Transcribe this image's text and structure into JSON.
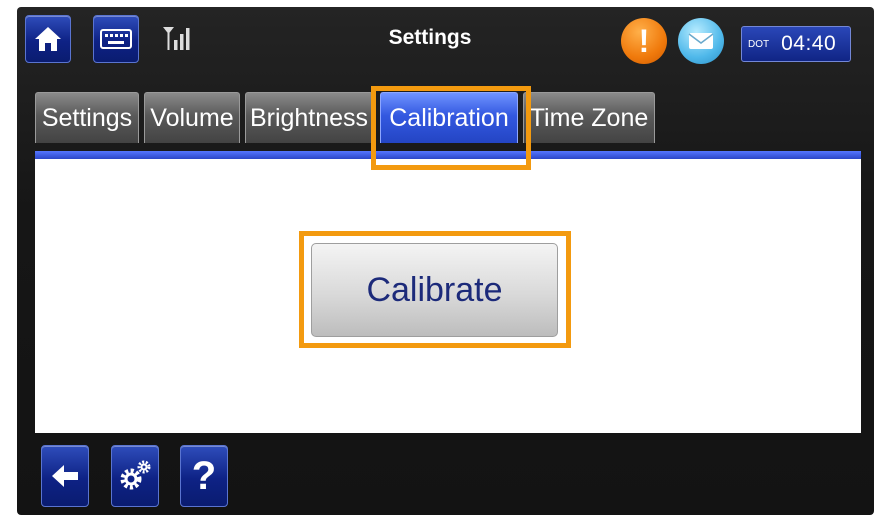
{
  "header": {
    "title": "Settings",
    "clock": {
      "timezone": "DOT",
      "time": "04:40"
    }
  },
  "tabs": [
    {
      "label": "Settings",
      "active": false
    },
    {
      "label": "Volume",
      "active": false
    },
    {
      "label": "Brightness",
      "active": false
    },
    {
      "label": "Calibration",
      "active": true
    },
    {
      "label": "Time Zone",
      "active": false
    }
  ],
  "main": {
    "calibrate_label": "Calibrate"
  },
  "footer": {
    "help_label": "?"
  },
  "icons": {
    "home": "home-icon",
    "keyboard": "keyboard-icon",
    "signal": "signal-icon",
    "alert": "alert-icon",
    "mail": "mail-icon",
    "back": "back-arrow-icon",
    "settings": "gear-icon"
  },
  "colors": {
    "accent_blue": "#2445c4",
    "highlight_orange": "#f39a0f",
    "alert_orange": "#f07a0c"
  }
}
